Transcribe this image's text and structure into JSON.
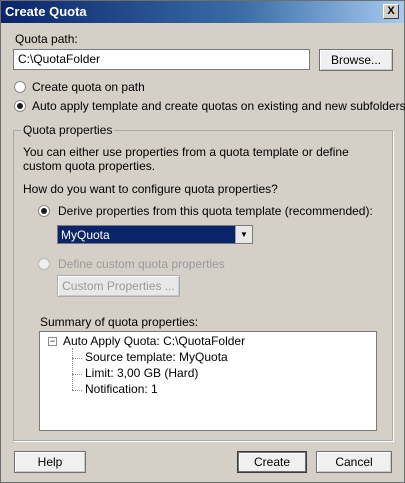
{
  "window": {
    "title": "Create Quota",
    "close_glyph": "X"
  },
  "quota_path": {
    "label": "Quota path:",
    "value": "C:\\QuotaFolder",
    "browse_label": "Browse..."
  },
  "scope": {
    "create_on_path_label": "Create quota on path",
    "auto_apply_label": "Auto apply template and create quotas on existing and new subfolders",
    "selected": "auto_apply"
  },
  "properties": {
    "group_title": "Quota properties",
    "description": "You can either use properties from a quota template or define custom quota properties.",
    "question": "How do you want to configure quota properties?",
    "derive_label": "Derive properties from this quota template (recommended):",
    "template_selected": "MyQuota",
    "custom_label": "Define custom quota properties",
    "custom_button_label": "Custom Properties ...",
    "summary_label": "Summary of quota properties:",
    "summary_root": "Auto Apply Quota: C:\\QuotaFolder",
    "summary_children": [
      "Source template: MyQuota",
      "Limit: 3,00 GB (Hard)",
      "Notification: 1"
    ]
  },
  "footer": {
    "help_label": "Help",
    "create_label": "Create",
    "cancel_label": "Cancel"
  }
}
